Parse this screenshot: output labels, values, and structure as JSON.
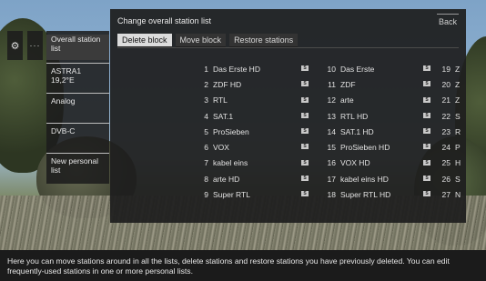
{
  "dialog": {
    "title": "Change overall station list",
    "back_label": "Back",
    "tabs": [
      {
        "label": "Delete block",
        "active": true
      },
      {
        "label": "Move block",
        "active": false
      },
      {
        "label": "Restore stations",
        "active": false
      }
    ]
  },
  "quick_icons": [
    {
      "icon": "gear-icon",
      "glyph": "⚙"
    },
    {
      "icon": "more-icon",
      "glyph": "···"
    }
  ],
  "sidebar": {
    "items": [
      {
        "label": "Overall station list",
        "active": true
      },
      {
        "label": "ASTRA1 19,2°E",
        "active": false
      },
      {
        "label": "Analog",
        "active": false
      },
      {
        "label": "DVB-C",
        "active": false
      },
      {
        "label": "New personal list",
        "active": false
      }
    ]
  },
  "stations": {
    "badge_text": "S",
    "col1": [
      {
        "num": "1",
        "name": "Das Erste HD"
      },
      {
        "num": "2",
        "name": "ZDF HD"
      },
      {
        "num": "3",
        "name": "RTL"
      },
      {
        "num": "4",
        "name": "SAT.1"
      },
      {
        "num": "5",
        "name": "ProSieben"
      },
      {
        "num": "6",
        "name": "VOX"
      },
      {
        "num": "7",
        "name": "kabel eins"
      },
      {
        "num": "8",
        "name": "arte HD"
      },
      {
        "num": "9",
        "name": "Super RTL"
      }
    ],
    "col2": [
      {
        "num": "10",
        "name": "Das Erste"
      },
      {
        "num": "11",
        "name": "ZDF"
      },
      {
        "num": "12",
        "name": "arte"
      },
      {
        "num": "13",
        "name": "RTL HD"
      },
      {
        "num": "14",
        "name": "SAT.1 HD"
      },
      {
        "num": "15",
        "name": "ProSieben HD"
      },
      {
        "num": "16",
        "name": "VOX HD"
      },
      {
        "num": "17",
        "name": "kabel eins HD"
      },
      {
        "num": "18",
        "name": "Super RTL HD"
      }
    ],
    "col3": [
      {
        "num": "19",
        "name": "Z"
      },
      {
        "num": "20",
        "name": "Z"
      },
      {
        "num": "21",
        "name": "Z"
      },
      {
        "num": "22",
        "name": "S"
      },
      {
        "num": "23",
        "name": "R"
      },
      {
        "num": "24",
        "name": "P"
      },
      {
        "num": "25",
        "name": "H"
      },
      {
        "num": "26",
        "name": "S"
      },
      {
        "num": "27",
        "name": "N"
      }
    ]
  },
  "info_text": "Here you can move stations around in all the lists, delete stations and restore stations you have previously deleted. You can edit frequently-used stations in one or more personal lists.",
  "colors": {
    "panel_bg": "#1e1e1e",
    "active_tab_bg": "#dcdcdc",
    "text": "#e2e2e2"
  }
}
